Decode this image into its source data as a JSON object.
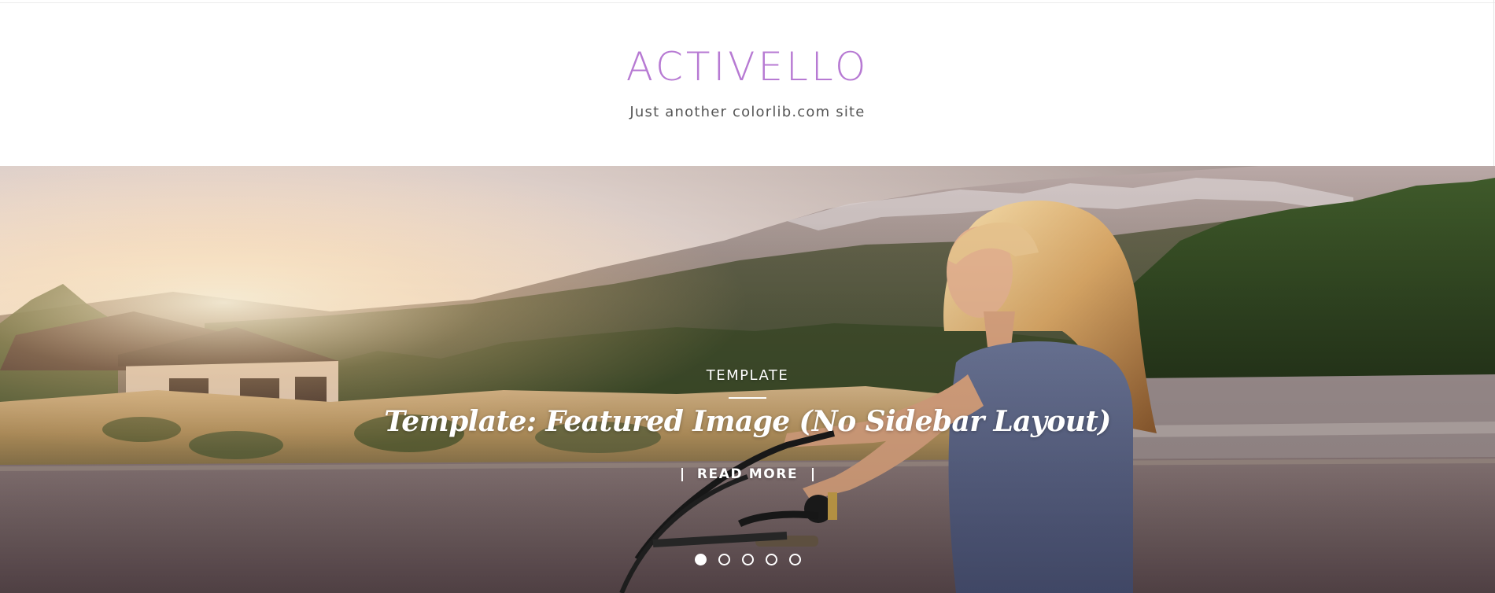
{
  "header": {
    "site_title": "ACTIVELLO",
    "tagline": "Just another colorlib.com site",
    "brand_color": "#b77ad3"
  },
  "hero": {
    "photo": "woman-riding-bicycle-at-sunset-photo",
    "slide": {
      "category": "TEMPLATE",
      "title": "Template: Featured Image (No Sidebar Layout)",
      "read_more": "READ MORE"
    },
    "pagination": {
      "count": 5,
      "active_index": 0
    }
  }
}
